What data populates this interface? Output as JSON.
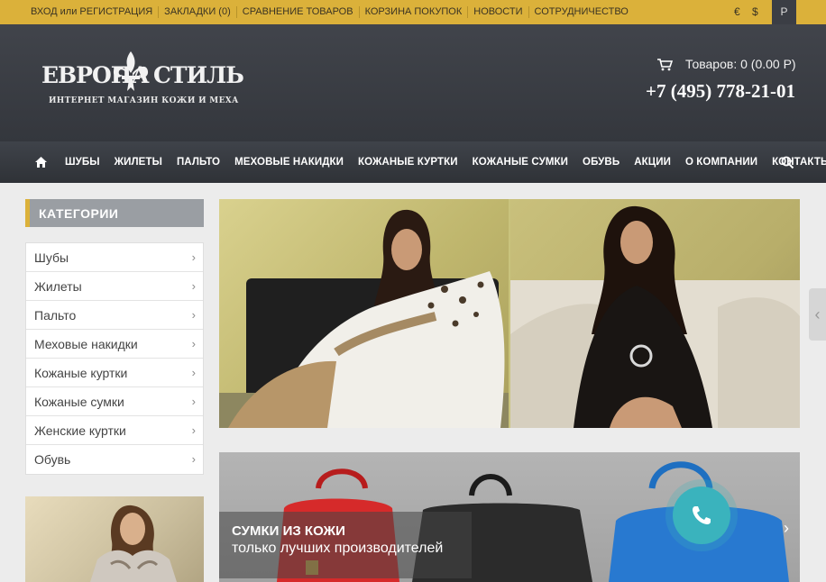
{
  "topbar": {
    "links": [
      "ВХОД или РЕГИСТРАЦИЯ",
      "ЗАКЛАДКИ (0)",
      "СРАВНЕНИЕ ТОВАРОВ",
      "КОРЗИНА ПОКУПОК",
      "НОВОСТИ",
      "СОТРУДНИЧЕСТВО"
    ],
    "currency_eur": "€",
    "currency_usd": "$",
    "language": "Р"
  },
  "header": {
    "logo_left": "ЕВРОПА",
    "logo_right": "СТИЛЬ",
    "logo_sub": "ИНТЕРНЕТ МАГАЗИН КОЖИ И МЕХА",
    "cart_text": "Товаров: 0 (0.00 Р)",
    "phone": "+7 (495) 778-21-01"
  },
  "nav": {
    "items": [
      "ШУБЫ",
      "ЖИЛЕТЫ",
      "ПАЛЬТО",
      "МЕХОВЫЕ НАКИДКИ",
      "КОЖАНЫЕ КУРТКИ",
      "КОЖАНЫЕ СУМКИ",
      "ОБУВЬ",
      "АКЦИИ",
      "О КОМПАНИИ",
      "КОНТАКТЫ"
    ]
  },
  "sidebar": {
    "title": "КАТЕГОРИИ",
    "items": [
      "Шубы",
      "Жилеты",
      "Пальто",
      "Меховые накидки",
      "Кожаные куртки",
      "Кожаные сумки",
      "Женские куртки",
      "Обувь"
    ]
  },
  "banner": {
    "promo_title": "СУМКИ ИЗ КОЖИ",
    "promo_subtitle": "только лучших производителей"
  },
  "colors": {
    "accent": "#dbb13a",
    "header_dark": "#3b3e45",
    "call_button": "#3ab3bd"
  }
}
